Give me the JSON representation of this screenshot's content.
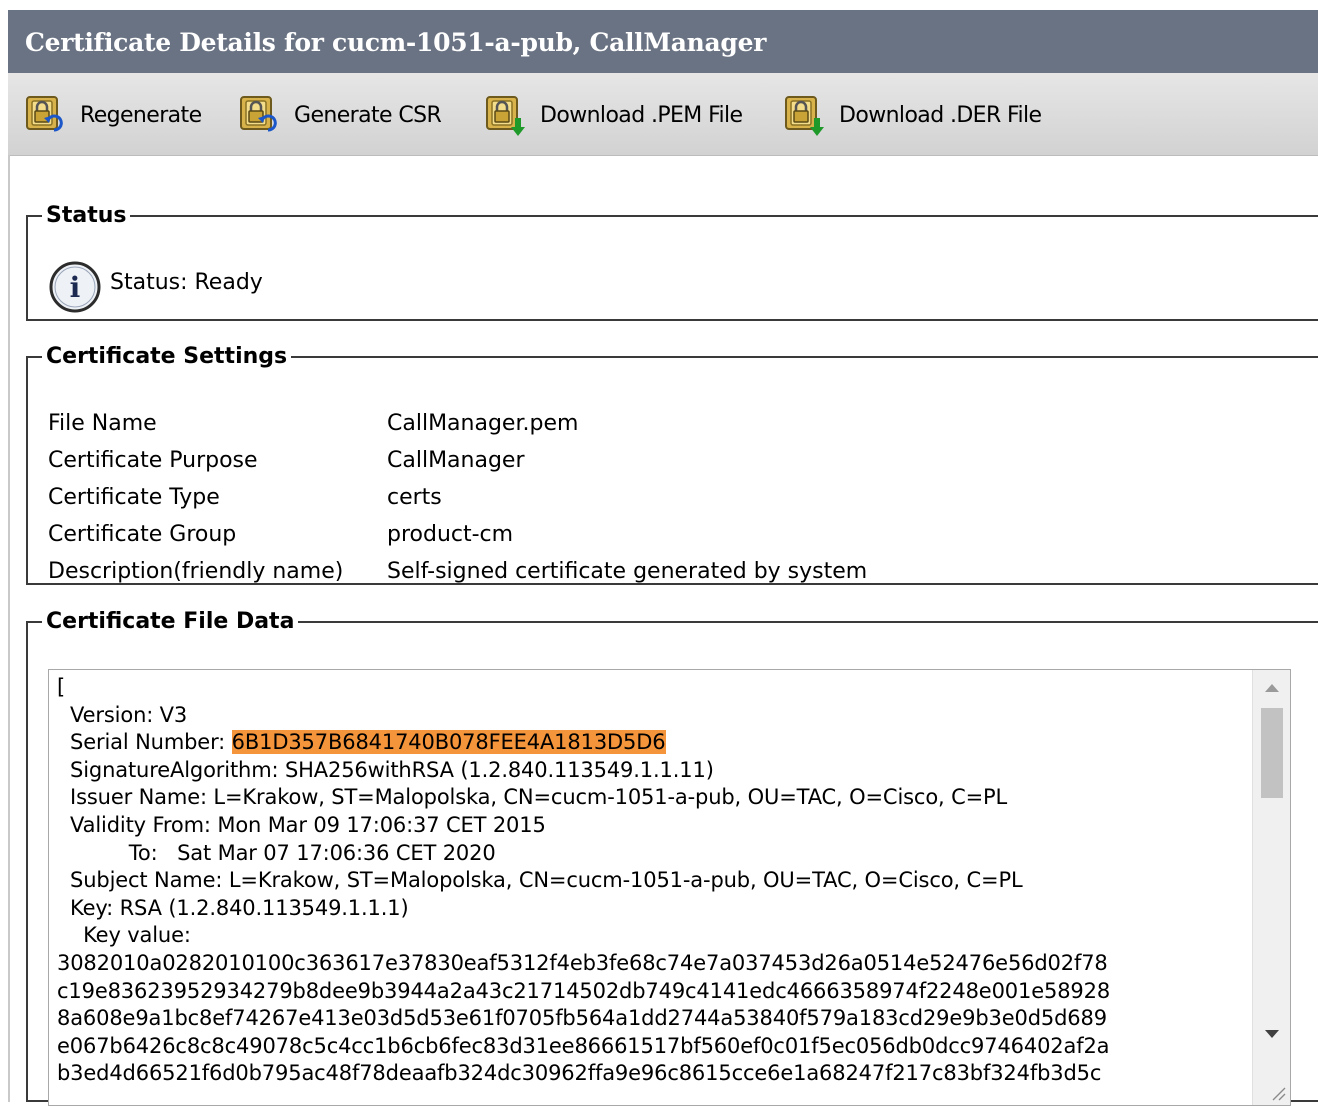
{
  "window": {
    "title": "Certificate Details for cucm-1051-a-pub, CallManager"
  },
  "toolbar": {
    "buttons": [
      {
        "label": "Regenerate",
        "icon": "lock-regenerate-icon"
      },
      {
        "label": "Generate CSR",
        "icon": "lock-regenerate-icon"
      },
      {
        "label": "Download .PEM File",
        "icon": "lock-download-icon"
      },
      {
        "label": "Download .DER File",
        "icon": "lock-download-icon"
      }
    ]
  },
  "status": {
    "legend": "Status",
    "text": "Status: Ready",
    "icon": "info-icon"
  },
  "settings": {
    "legend": "Certificate Settings",
    "rows": [
      {
        "key": "File Name",
        "value": "CallManager.pem"
      },
      {
        "key": "Certificate Purpose",
        "value": "CallManager"
      },
      {
        "key": "Certificate Type",
        "value": "certs"
      },
      {
        "key": "Certificate Group",
        "value": "product-cm"
      },
      {
        "key": "Description(friendly name)",
        "value": "Self-signed certificate generated by system"
      }
    ]
  },
  "file_data": {
    "legend": "Certificate File Data",
    "line_open": "[",
    "version": "  Version: V3",
    "serial_prefix": "  Serial Number: ",
    "serial_value": "6B1D357B6841740B078FEE4A1813D5D6",
    "lines_after_serial": [
      "  SignatureAlgorithm: SHA256withRSA (1.2.840.113549.1.1.11)",
      "  Issuer Name: L=Krakow, ST=Malopolska, CN=cucm-1051-a-pub, OU=TAC, O=Cisco, C=PL",
      "  Validity From: Mon Mar 09 17:06:37 CET 2015",
      "           To:   Sat Mar 07 17:06:36 CET 2020",
      "  Subject Name: L=Krakow, ST=Malopolska, CN=cucm-1051-a-pub, OU=TAC, O=Cisco, C=PL",
      "  Key: RSA (1.2.840.113549.1.1.1)",
      "    Key value:",
      "3082010a0282010100c363617e37830eaf5312f4eb3fe68c74e7a037453d26a0514e52476e56d02f78",
      "c19e83623952934279b8dee9b3944a2a43c21714502db749c4141edc4666358974f2248e001e58928",
      "8a608e9a1bc8ef74267e413e03d5d53e61f0705fb564a1dd2744a53840f579a183cd29e9b3e0d5d689",
      "e067b6426c8c8c49078c5c4cc1b6cb6fec83d31ee86661517bf560ef0c01f5ec056db0dcc9746402af2a",
      "b3ed4d66521f6d0b795ac48f78deaafb324dc30962ffa9e96c8615cce6e1a68247f217c83bf324fb3d5c"
    ],
    "highlight_color": "#f5953b"
  },
  "colors": {
    "titlebar": "#6a7383",
    "toolbar": "#dcdcdc"
  }
}
